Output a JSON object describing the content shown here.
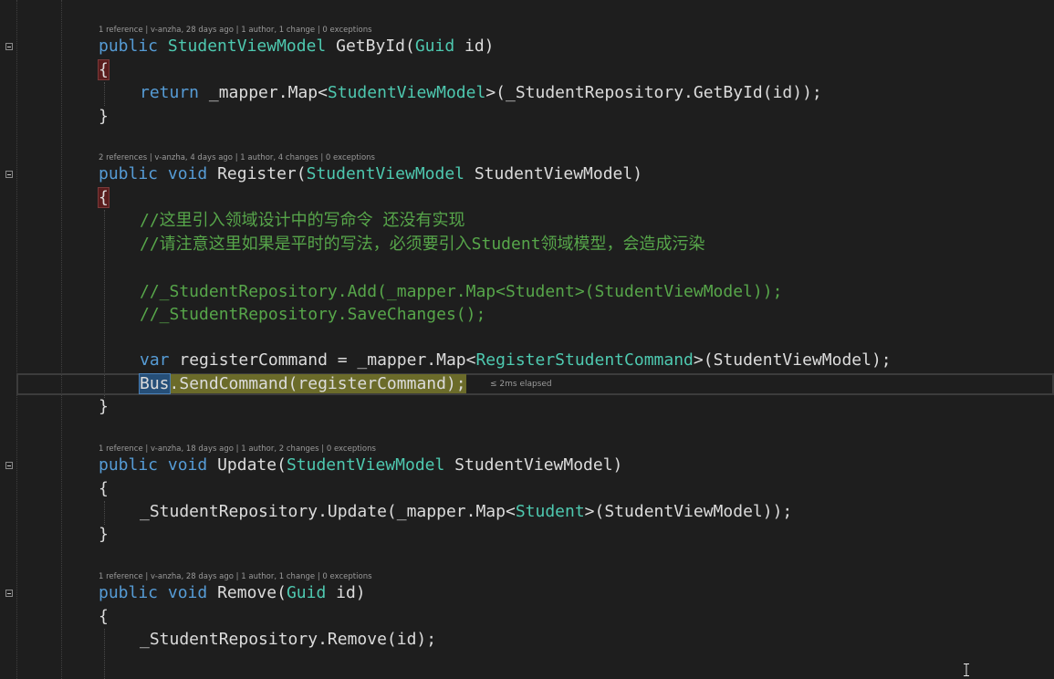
{
  "lenses": {
    "getbyid": "1 reference | v-anzha, 28 days ago | 1 author, 1 change | 0 exceptions",
    "register": "2 references | v-anzha, 4 days ago | 1 author, 4 changes | 0 exceptions",
    "update": "1 reference | v-anzha, 18 days ago | 1 author, 2 changes | 0 exceptions",
    "remove": "1 reference | v-anzha, 28 days ago | 1 author, 1 change | 0 exceptions"
  },
  "tokens": {
    "public": "public",
    "void": "void",
    "return": "return",
    "var": "var",
    "open_brace": "{",
    "close_brace": "}",
    "guid": "Guid",
    "student_view_model": "StudentViewModel",
    "student": "Student",
    "register_student_command": "RegisterStudentCommand",
    "bus": "Bus"
  },
  "code": {
    "getbyid_name": " GetById(",
    "getbyid_param": " id)",
    "return_pre": " _mapper.Map<",
    "return_post": ">(_StudentRepository.GetById(id));",
    "register_name": " Register(",
    "register_param": " StudentViewModel)",
    "comment1": "//这里引入领域设计中的写命令 还没有实现",
    "comment2": "//请注意这里如果是平时的写法，必须要引入Student领域模型，会造成污染",
    "comment3": "//_StudentRepository.Add(_mapper.Map<Student>(StudentViewModel));",
    "comment4": "//_StudentRepository.SaveChanges();",
    "var_pre": " registerCommand = _mapper.Map<",
    "var_post": ">(StudentViewModel);",
    "send_command": ".SendCommand(registerCommand);",
    "update_name": " Update(",
    "update_param": " StudentViewModel)",
    "update_body_pre": "_StudentRepository.Update(_mapper.Map<",
    "update_body_post": ">(StudentViewModel));",
    "remove_name": " Remove(",
    "remove_param": " id)",
    "remove_body": "_StudentRepository.Remove(id);"
  },
  "elapsed_hint": "≤ 2ms elapsed",
  "icons": {
    "fold": "collapse-minus-icon",
    "cursor": "ibeam-cursor-icon"
  }
}
